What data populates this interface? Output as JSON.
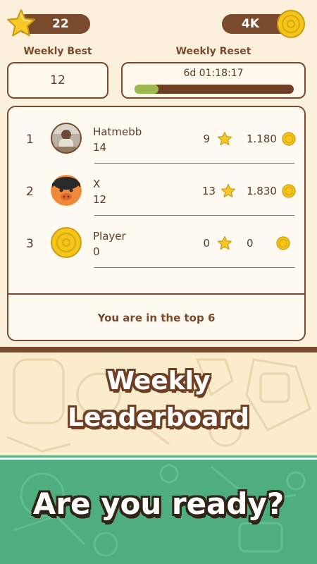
{
  "header": {
    "stars_count": "22",
    "coins_count": "4K"
  },
  "weekly_best": {
    "label": "Weekly Best",
    "value": "12"
  },
  "weekly_reset": {
    "label": "Weekly Reset",
    "time_left": "6d 01:18:17",
    "progress_fraction": 0.15
  },
  "leaderboard": {
    "rows": [
      {
        "rank": "1",
        "name": "Hatmebb",
        "best": "14",
        "stars": "9",
        "coins": "1.180",
        "avatar": "photo-avatar"
      },
      {
        "rank": "2",
        "name": "X",
        "best": "12",
        "stars": "13",
        "coins": "1.830",
        "avatar": "pig-avatar"
      },
      {
        "rank": "3",
        "name": "Player",
        "best": "0",
        "stars": "0",
        "coins": "0",
        "avatar": "coin-avatar"
      }
    ],
    "footer_text": "You are in the top 6"
  },
  "promo": {
    "line1": "Weekly",
    "line2": "Leaderboard",
    "line3": "Are you ready?"
  },
  "colors": {
    "brown": "#7a4a2c",
    "cream": "#fbf0dc",
    "green": "#4fae7f",
    "gold": "#f5c518"
  }
}
